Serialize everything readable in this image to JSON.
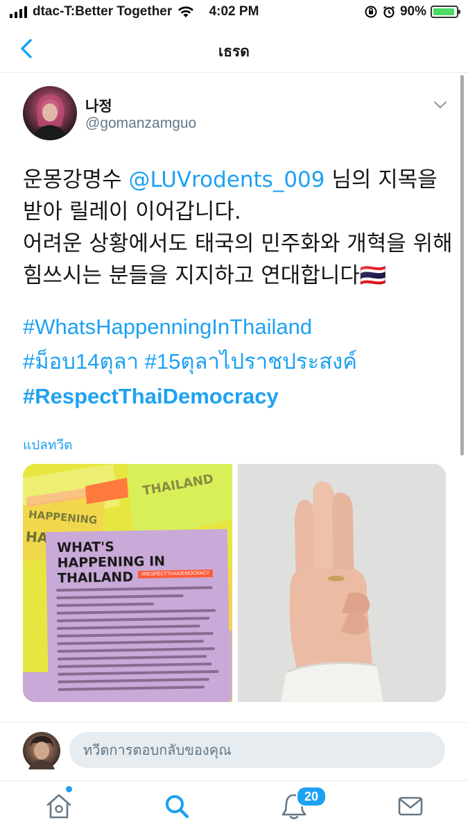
{
  "status_bar": {
    "carrier": "dtac-T:Better Together",
    "time": "4:02 PM",
    "battery": "90%"
  },
  "nav": {
    "title": "เธรด",
    "back_icon": "chevron-left-icon"
  },
  "tweet": {
    "display_name": "나정",
    "handle": "@gomanzamguo",
    "text_before_mention": "운몽강명수 ",
    "mention": "@LUVrodents_009",
    "text_after_mention": " 님의 지목을 받아 릴레이 이어갑니다.",
    "text_line2": "어려운 상황에서도 태국의 민주화와 개혁을 위해 힘쓰시는 분들을 지지하고 연대합니다🇹🇭",
    "hashtags": [
      "#WhatsHappenningInThailand",
      "#ม็อบ14ตุลา #15ตุลาไปราชประสงค์",
      "#RespectThaiDemocracy"
    ],
    "translate_label": "แปลทวีต",
    "media": {
      "poster_title": "WHAT'S HAPPENING IN THAILAND",
      "poster_tag": "#RESPECTTHAIDEMOCRACY",
      "sticker_text_1": "HAPPENING",
      "sticker_text_2": "HAILAND",
      "sticker_text_3": "THAILAND"
    }
  },
  "reply": {
    "placeholder": "ทวีตการตอบกลับของคุณ"
  },
  "tabbar": {
    "home_icon": "home-icon",
    "search_icon": "search-icon",
    "notifications_icon": "bell-icon",
    "notifications_count": "20",
    "messages_icon": "mail-icon"
  },
  "colors": {
    "accent": "#1da1f2",
    "text": "#14171a",
    "secondary_text": "#657786",
    "divider": "#e6ecf0"
  }
}
